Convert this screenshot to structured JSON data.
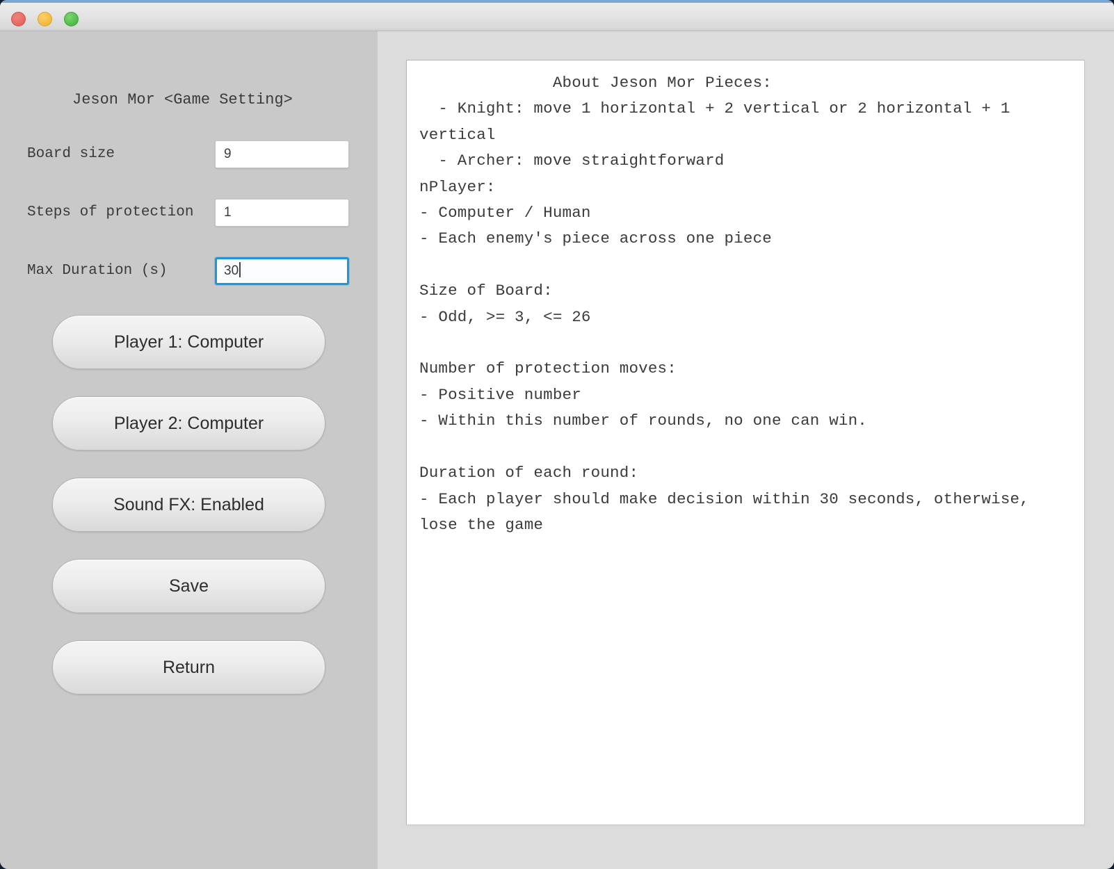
{
  "window": {
    "traffic_lights": [
      "close",
      "minimize",
      "maximize"
    ]
  },
  "settings_panel": {
    "title": "Jeson Mor <Game Setting>",
    "fields": [
      {
        "label": "Board size",
        "value": "9",
        "focused": false
      },
      {
        "label": "Steps of protection",
        "value": "1",
        "focused": false
      },
      {
        "label": "Max Duration (s)",
        "value": "30",
        "focused": true
      }
    ],
    "buttons": [
      {
        "label": "Player 1: Computer"
      },
      {
        "label": "Player 2: Computer"
      },
      {
        "label": "Sound FX: Enabled"
      },
      {
        "label": "Save"
      },
      {
        "label": "Return"
      }
    ]
  },
  "info_panel": {
    "text": "              About Jeson Mor Pieces:\n  - Knight: move 1 horizontal + 2 vertical or 2 horizontal + 1 vertical\n  - Archer: move straightforward\nnPlayer:\n- Computer / Human\n- Each enemy's piece across one piece\n\nSize of Board:\n- Odd, >= 3, <= 26\n\nNumber of protection moves:\n- Positive number\n- Within this number of rounds, no one can win.\n\nDuration of each round:\n- Each player should make decision within 30 seconds, otherwise, lose the game"
  },
  "colors": {
    "left_panel_bg": "#c9c9c9",
    "right_panel_bg": "#dcdcdc",
    "focus_border": "#2196d6",
    "titlebar_accent": "#7aa7d4",
    "desktop_bg": "#12202e"
  }
}
